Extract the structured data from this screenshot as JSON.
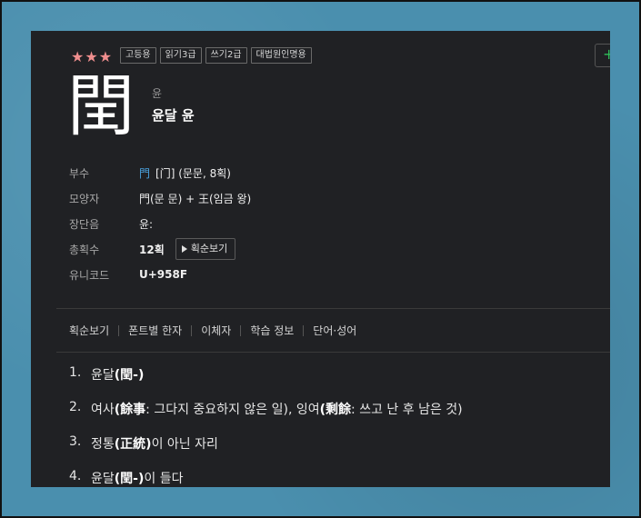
{
  "rating": {
    "stars": "★★★"
  },
  "badges": [
    "고등용",
    "읽기3급",
    "쓰기2급",
    "대법원인명용"
  ],
  "add_button": {
    "label": "+"
  },
  "hanja": {
    "character": "閏",
    "reading": "윤",
    "meaning": "윤달 윤"
  },
  "info": {
    "radical": {
      "label": "부수",
      "glyph": "門",
      "text": "[门] (문문, 8획)"
    },
    "shape": {
      "label": "모양자",
      "text": "門(문 문) + 王(임금 왕)"
    },
    "vowel_length": {
      "label": "장단음",
      "text": "윤:"
    },
    "strokes": {
      "label": "총획수",
      "value": "12획",
      "button": "획순보기"
    },
    "unicode": {
      "label": "유니코드",
      "value": "U+958F"
    }
  },
  "tabs": [
    "획순보기",
    "폰트별 한자",
    "이체자",
    "학습 정보",
    "단어·성어"
  ],
  "meanings": [
    {
      "num": "1.",
      "parts": [
        {
          "t": "윤달"
        },
        {
          "t": "(閏-)",
          "b": true
        }
      ]
    },
    {
      "num": "2.",
      "parts": [
        {
          "t": "여사"
        },
        {
          "t": "(餘事",
          "b": true
        },
        {
          "t": ": 그다지 중요하지 않은 일), 잉여"
        },
        {
          "t": "(剩餘",
          "b": true
        },
        {
          "t": ": 쓰고 난 후 남은 것)"
        }
      ]
    },
    {
      "num": "3.",
      "parts": [
        {
          "t": "정통"
        },
        {
          "t": "(正統)",
          "b": true
        },
        {
          "t": "이 아닌 자리"
        }
      ]
    },
    {
      "num": "4.",
      "parts": [
        {
          "t": "윤달"
        },
        {
          "t": "(閏-)",
          "b": true
        },
        {
          "t": "이 들다"
        }
      ]
    }
  ]
}
